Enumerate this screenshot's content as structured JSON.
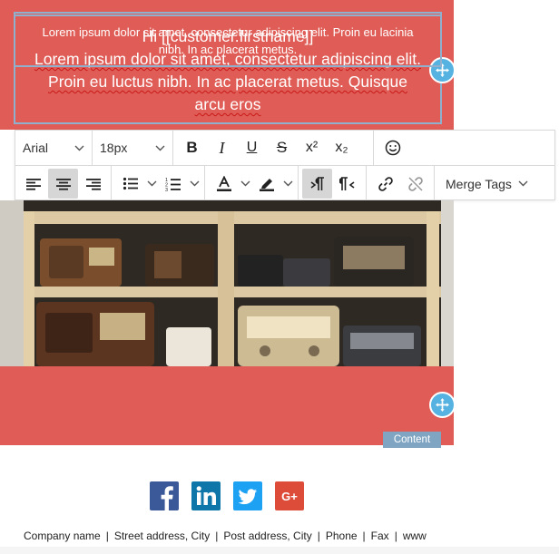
{
  "header_block": {
    "lines": [
      "Hi [[customer.firstname]]",
      "Lorem ipsum dolor sit amet, consectetur adipiscing elit.",
      "Proin eu luctus nibh. In ac placerat metus. Quisque",
      "arcu eros"
    ]
  },
  "toolbar": {
    "font_family": "Arial",
    "font_size": "18px",
    "bold": "B",
    "italic": "I",
    "underline": "U",
    "strikethrough": "S",
    "superscript": "x²",
    "subscript": "x₂",
    "merge_tags": "Merge Tags",
    "icons": {
      "emoji": "smiley-icon",
      "align_left": "align-left-icon",
      "align_center": "align-center-icon",
      "align_right": "align-right-icon",
      "bullets": "bullet-list-icon",
      "numbers": "numbered-list-icon",
      "text_color": "text-color-icon",
      "highlight": "highlight-icon",
      "ltr": "ltr-icon",
      "rtl": "rtl-icon",
      "link": "link-icon",
      "unlink": "unlink-icon"
    }
  },
  "image_block": {
    "alt": "vintage radios on wooden shelves"
  },
  "body_block": {
    "lines": [
      "Lorem ipsum dolor sit amet, consectetur adipiscing elit. Proin eu lacinia",
      "nibh. In ac placerat metus."
    ]
  },
  "content_tag": "Content",
  "social": [
    "facebook-icon",
    "linkedin-icon",
    "twitter-icon",
    "google-plus-icon"
  ],
  "footer": {
    "company": "Company name",
    "street": "Street address, City",
    "post": "Post address, City",
    "phone": "Phone",
    "fax": "Fax",
    "web": "www"
  },
  "colors": {
    "brand_red": "#df5d56",
    "selection_border": "#8fb1cd",
    "handle_blue": "#56b2e0",
    "facebook": "#3b5998",
    "linkedin": "#0e76a8",
    "twitter": "#1da1f2",
    "google_plus": "#dd4b39"
  }
}
